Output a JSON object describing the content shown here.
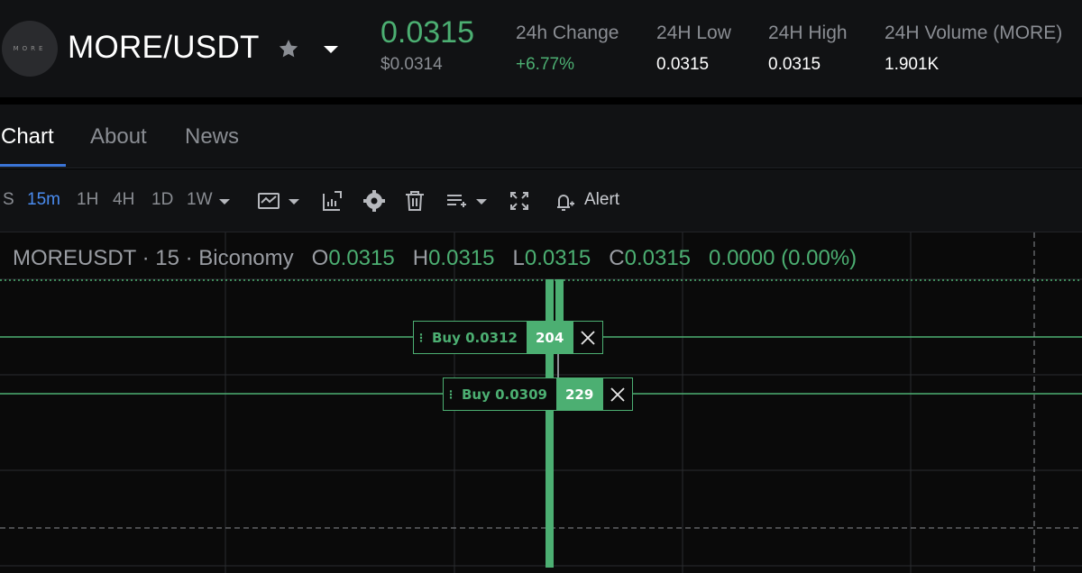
{
  "header": {
    "logo_text": "MORE",
    "pair": "MORE/USDT",
    "last_price": "0.0315",
    "last_price_usd": "$0.0314",
    "stats": [
      {
        "label": "24h Change",
        "value": "+6.77%"
      },
      {
        "label": "24H Low",
        "value": "0.0315"
      },
      {
        "label": "24H High",
        "value": "0.0315"
      },
      {
        "label": "24H Volume (MORE)",
        "value": "1.901K"
      }
    ]
  },
  "tabs": [
    "Chart",
    "About",
    "News"
  ],
  "toolbar": {
    "timeframes": [
      "S",
      "15m",
      "1H",
      "4H",
      "1D",
      "1W"
    ],
    "active_timeframe": "15m",
    "alert_label": "Alert",
    "icons": [
      "chart-type-icon",
      "indicators-icon",
      "settings-icon",
      "trash-icon",
      "layers-icon",
      "fullscreen-icon",
      "alert-icon"
    ]
  },
  "chart": {
    "symbol_line": "MOREUSDT · 15 · Biconomy",
    "ohlc": {
      "o_key": "O",
      "o": "0.0315",
      "h_key": "H",
      "h": "0.0315",
      "l_key": "L",
      "l": "0.0315",
      "c_key": "C",
      "c": "0.0315",
      "change": "0.0000 (0.00%)"
    },
    "orders": [
      {
        "label": "Buy 0.0312",
        "qty": "204"
      },
      {
        "label": "Buy 0.0309",
        "qty": "229"
      }
    ],
    "colors": {
      "up": "#4caf72",
      "grid": "#2a2c30",
      "accent": "#3a74d6"
    }
  }
}
